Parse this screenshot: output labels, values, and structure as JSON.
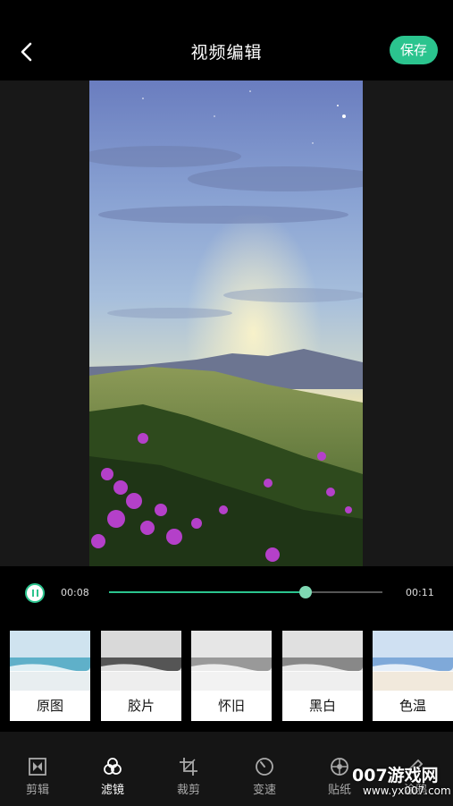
{
  "header": {
    "title": "视频编辑",
    "save_label": "保存"
  },
  "player": {
    "current_time": "00:08",
    "total_time": "00:11",
    "progress": 0.72
  },
  "filters": [
    {
      "label": "原图",
      "style": "original"
    },
    {
      "label": "胶片",
      "style": "film"
    },
    {
      "label": "怀旧",
      "style": "nostalgic"
    },
    {
      "label": "黑白",
      "style": "bw"
    },
    {
      "label": "色温",
      "style": "warm"
    }
  ],
  "tabs": [
    {
      "label": "剪辑",
      "icon": "clip-icon",
      "active": false
    },
    {
      "label": "滤镜",
      "icon": "filter-icon",
      "active": true
    },
    {
      "label": "裁剪",
      "icon": "crop-icon",
      "active": false
    },
    {
      "label": "变速",
      "icon": "speed-icon",
      "active": false
    },
    {
      "label": "贴纸",
      "icon": "sticker-icon",
      "active": false
    },
    {
      "label": "涂鸦",
      "icon": "doodle-icon",
      "active": false
    }
  ],
  "watermark": {
    "brand": "007游戏网",
    "url": "www.yx007.com"
  },
  "colors": {
    "accent": "#2bc48e",
    "background": "#000000"
  }
}
